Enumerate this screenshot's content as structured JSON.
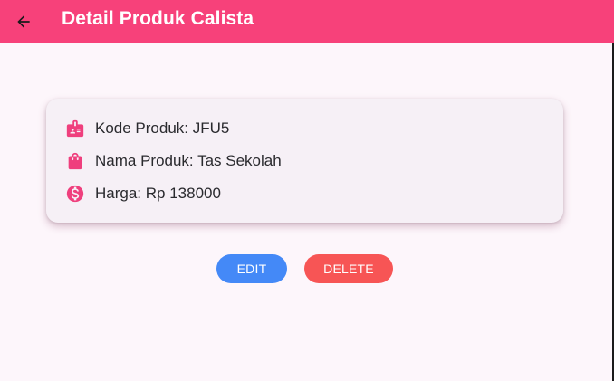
{
  "appbar": {
    "title": "Detail Produk Calista",
    "back_icon": "arrow-back-icon",
    "color": "#f7417a"
  },
  "product": {
    "fields": [
      {
        "icon": "id-badge-icon",
        "label": "Kode Produk: JFU5"
      },
      {
        "icon": "shopping-bag-icon",
        "label": "Nama Produk: Tas Sekolah"
      },
      {
        "icon": "dollar-circle-icon",
        "label": "Harga: Rp 138000"
      }
    ],
    "icon_color": "#ef3f7d"
  },
  "actions": {
    "edit_label": "EDIT",
    "edit_color": "#4489f7",
    "delete_label": "DELETE",
    "delete_color": "#f75555"
  }
}
